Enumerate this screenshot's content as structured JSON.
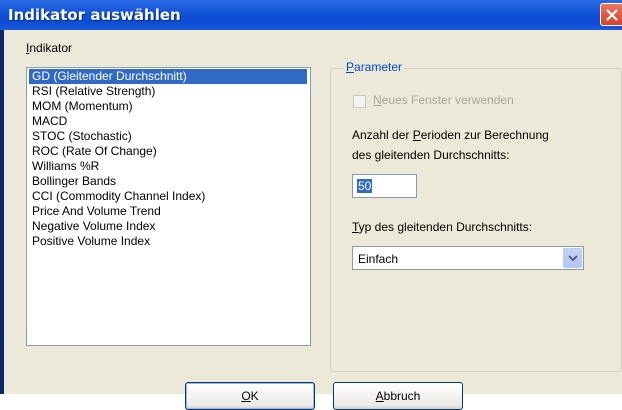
{
  "dialog": {
    "title": "Indikator auswählen"
  },
  "indicator_list": {
    "label": "Indikator",
    "items": [
      "GD (Gleitender Durchschnitt)",
      "RSI (Relative Strength)",
      "MOM (Momentum)",
      "MACD",
      "STOC (Stochastic)",
      "ROC (Rate Of Change)",
      "Williams %R",
      "Bollinger Bands",
      "CCI (Commodity Channel Index)",
      "Price And Volume Trend",
      "Negative Volume Index",
      "Positive Volume Index"
    ],
    "selected": "GD (Gleitender Durchschnitt)"
  },
  "parameters": {
    "legend": "Parameter",
    "new_window_label": "Neues Fenster verwenden",
    "periods_label_line1": "Anzahl der Perioden zur Berechnung",
    "periods_label_line2": "des gleitenden Durchschnitts:",
    "periods_value": "50",
    "type_label": "Typ des gleitenden Durchschnitts:",
    "type_value": "Einfach"
  },
  "buttons": {
    "ok": "OK",
    "cancel": "Abbruch"
  },
  "colors": {
    "title_bar": "#0b4bd0",
    "selection": "#316ac5",
    "dialog_bg": "#ece9d8"
  }
}
